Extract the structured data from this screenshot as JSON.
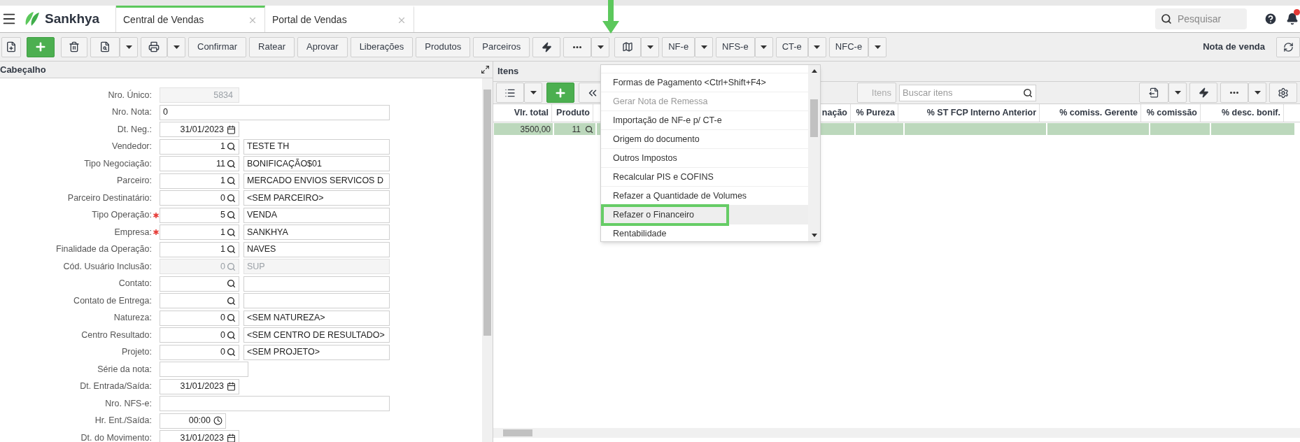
{
  "header": {
    "brand": "Sankhya",
    "tabs": [
      {
        "label": "Central de Vendas",
        "selected": true
      },
      {
        "label": "Portal de Vendas",
        "selected": false
      }
    ],
    "search_placeholder": "Pesquisar"
  },
  "toolbar": {
    "actions": [
      "Confirmar",
      "Ratear",
      "Aprovar",
      "Liberações",
      "Produtos",
      "Parceiros"
    ],
    "documents": [
      "NF-e",
      "NFS-e",
      "CT-e",
      "NFC-e"
    ],
    "screen_title": "Nota de venda"
  },
  "header_panel": {
    "title": "Cabeçalho",
    "fields": [
      {
        "kind": "number",
        "label": "Nro. Único:",
        "value": "5834",
        "disabled": true,
        "required": false
      },
      {
        "kind": "wide",
        "label": "Nro. Nota:",
        "value": "0",
        "disabled": false,
        "required": false
      },
      {
        "kind": "date",
        "label": "Dt. Neg.:",
        "value": "31/01/2023",
        "disabled": false,
        "required": false
      },
      {
        "kind": "lookup",
        "label": "Vendedor:",
        "code": "1",
        "description": "TESTE TH",
        "disabled": false,
        "required": false
      },
      {
        "kind": "lookup",
        "label": "Tipo Negociação:",
        "code": "11",
        "description": "BONIFICAÇÃO$01",
        "disabled": false,
        "required": false
      },
      {
        "kind": "lookup",
        "label": "Parceiro:",
        "code": "1",
        "description": "MERCADO ENVIOS SERVICOS D",
        "disabled": false,
        "required": false
      },
      {
        "kind": "lookup",
        "label": "Parceiro Destinatário:",
        "code": "0",
        "description": "<SEM PARCEIRO>",
        "disabled": false,
        "required": false
      },
      {
        "kind": "lookup",
        "label": "Tipo Operação:",
        "code": "5",
        "description": "VENDA",
        "disabled": false,
        "required": true
      },
      {
        "kind": "lookup",
        "label": "Empresa:",
        "code": "1",
        "description": "SANKHYA",
        "disabled": false,
        "required": true
      },
      {
        "kind": "lookup",
        "label": "Finalidade da Operação:",
        "code": "1",
        "description": "NAVES",
        "disabled": false,
        "required": false
      },
      {
        "kind": "lookup",
        "label": "Cód. Usuário Inclusão:",
        "code": "0",
        "description": "SUP",
        "disabled": true,
        "required": false
      },
      {
        "kind": "lookup",
        "label": "Contato:",
        "disabled": false,
        "required": false
      },
      {
        "kind": "lookup",
        "label": "Contato de Entrega:",
        "disabled": false,
        "required": false
      },
      {
        "kind": "lookup",
        "label": "Natureza:",
        "code": "0",
        "description": "<SEM NATUREZA>",
        "disabled": false,
        "required": false
      },
      {
        "kind": "lookup",
        "label": "Centro Resultado:",
        "code": "0",
        "description": "<SEM CENTRO DE RESULTADO>",
        "disabled": false,
        "required": false
      },
      {
        "kind": "lookup",
        "label": "Projeto:",
        "code": "0",
        "description": "<SEM PROJETO>",
        "disabled": false,
        "required": false
      },
      {
        "kind": "short",
        "label": "Série da nota:",
        "disabled": false,
        "required": false
      },
      {
        "kind": "date",
        "label": "Dt. Entrada/Saída:",
        "value": "31/01/2023",
        "disabled": false,
        "required": false
      },
      {
        "kind": "wide",
        "label": "Nro. NFS-e:",
        "disabled": false,
        "required": false
      },
      {
        "kind": "time",
        "label": "Hr. Ent./Saída:",
        "value": "00:00",
        "disabled": false,
        "required": false
      },
      {
        "kind": "date",
        "label": "Dt. do Movimento:",
        "value": "31/01/2023",
        "disabled": false,
        "required": false
      }
    ]
  },
  "items_panel": {
    "title": "Itens",
    "items_button": "Itens",
    "search_placeholder": "Buscar itens",
    "columns": [
      {
        "label": "Vlr. total",
        "kind": "text"
      },
      {
        "label": "Produto",
        "kind": "lookup"
      },
      {
        "label": "nação",
        "kind": "text"
      },
      {
        "label": "% Pureza",
        "kind": "text"
      },
      {
        "label": "% ST FCP Interno Anterior",
        "kind": "text"
      },
      {
        "label": "% comiss. Gerente",
        "kind": "text"
      },
      {
        "label": "% comissão",
        "kind": "text"
      },
      {
        "label": "% desc. bonif.",
        "kind": "text"
      }
    ],
    "rows": [
      {
        "selected": true,
        "cells": [
          "3500,00",
          "11",
          "",
          "",
          "",
          "",
          "",
          ""
        ]
      }
    ]
  },
  "menu": {
    "items": [
      {
        "label": "Formas de Pagamento <Ctrl+Shift+F4>",
        "disabled": false,
        "selected": false,
        "annotated": false
      },
      {
        "label": "Gerar Nota de Remessa",
        "disabled": true,
        "selected": false,
        "annotated": false
      },
      {
        "label": "Importação de NF-e p/ CT-e",
        "disabled": false,
        "selected": false,
        "annotated": false
      },
      {
        "label": "Origem do documento",
        "disabled": false,
        "selected": false,
        "annotated": false
      },
      {
        "label": "Outros Impostos",
        "disabled": false,
        "selected": false,
        "annotated": false
      },
      {
        "label": "Recalcular PIS e COFINS",
        "disabled": false,
        "selected": false,
        "annotated": false
      },
      {
        "label": "Refazer a Quantidade de Volumes",
        "disabled": false,
        "selected": false,
        "annotated": false
      },
      {
        "label": "Refazer o Financeiro",
        "disabled": false,
        "selected": true,
        "annotated": true
      },
      {
        "label": "Rentabilidade",
        "disabled": false,
        "selected": false,
        "annotated": false
      }
    ]
  }
}
